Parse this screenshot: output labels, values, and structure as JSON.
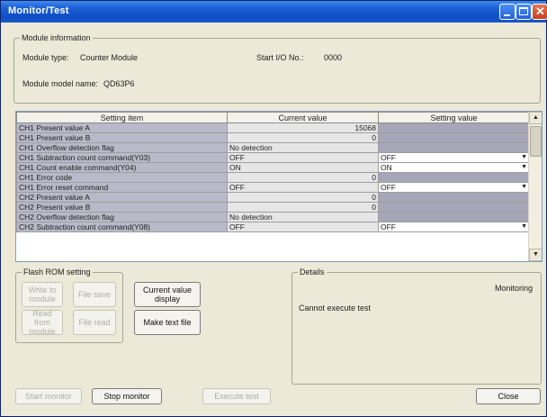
{
  "window": {
    "title": "Monitor/Test"
  },
  "module_info": {
    "legend": "Module information",
    "type_label": "Module type:",
    "type_value": "Counter Module",
    "io_label": "Start I/O No.:",
    "io_value": "0000",
    "model_label": "Module model name:",
    "model_value": "QD63P6"
  },
  "grid": {
    "headers": [
      "Setting item",
      "Current value",
      "Setting value"
    ],
    "rows": [
      {
        "item": "CH1 Present value A",
        "current": "15068",
        "setting": ""
      },
      {
        "item": "CH1 Present value B",
        "current": "0",
        "setting": ""
      },
      {
        "item": "CH1 Overflow detection flag",
        "current": "No detection",
        "setting": ""
      },
      {
        "item": "CH1 Subtraction count command(Y03)",
        "current": "OFF",
        "setting": "OFF"
      },
      {
        "item": "CH1 Count enable command(Y04)",
        "current": "ON",
        "setting": "ON"
      },
      {
        "item": "CH1 Error code",
        "current": "0",
        "setting": ""
      },
      {
        "item": "CH1 Error reset command",
        "current": "OFF",
        "setting": "OFF"
      },
      {
        "item": "CH2 Present value A",
        "current": "0",
        "setting": ""
      },
      {
        "item": "CH2 Present value B",
        "current": "0",
        "setting": ""
      },
      {
        "item": "CH2 Overflow detection flag",
        "current": "No detection",
        "setting": ""
      },
      {
        "item": "CH2 Subtraction count command(Y08)",
        "current": "OFF",
        "setting": "OFF"
      }
    ]
  },
  "flash_rom": {
    "legend": "Flash ROM setting",
    "write_to_module": "Write to module",
    "file_save": "File save",
    "read_from_module": "Read from module",
    "file_read": "File read"
  },
  "actions": {
    "current_value_display": "Current value display",
    "make_text_file": "Make text file"
  },
  "details": {
    "legend": "Details",
    "status": "Monitoring",
    "message": "Cannot execute test"
  },
  "footer": {
    "start_monitor": "Start monitor",
    "stop_monitor": "Stop monitor",
    "execute_test": "Execute test",
    "close": "Close"
  },
  "colors": {
    "titlebar": "#1F62D6",
    "dialog_bg": "#ECE9D8",
    "item_cell": "#B9B9C9",
    "readonly_setting": "#A6A6B8"
  }
}
